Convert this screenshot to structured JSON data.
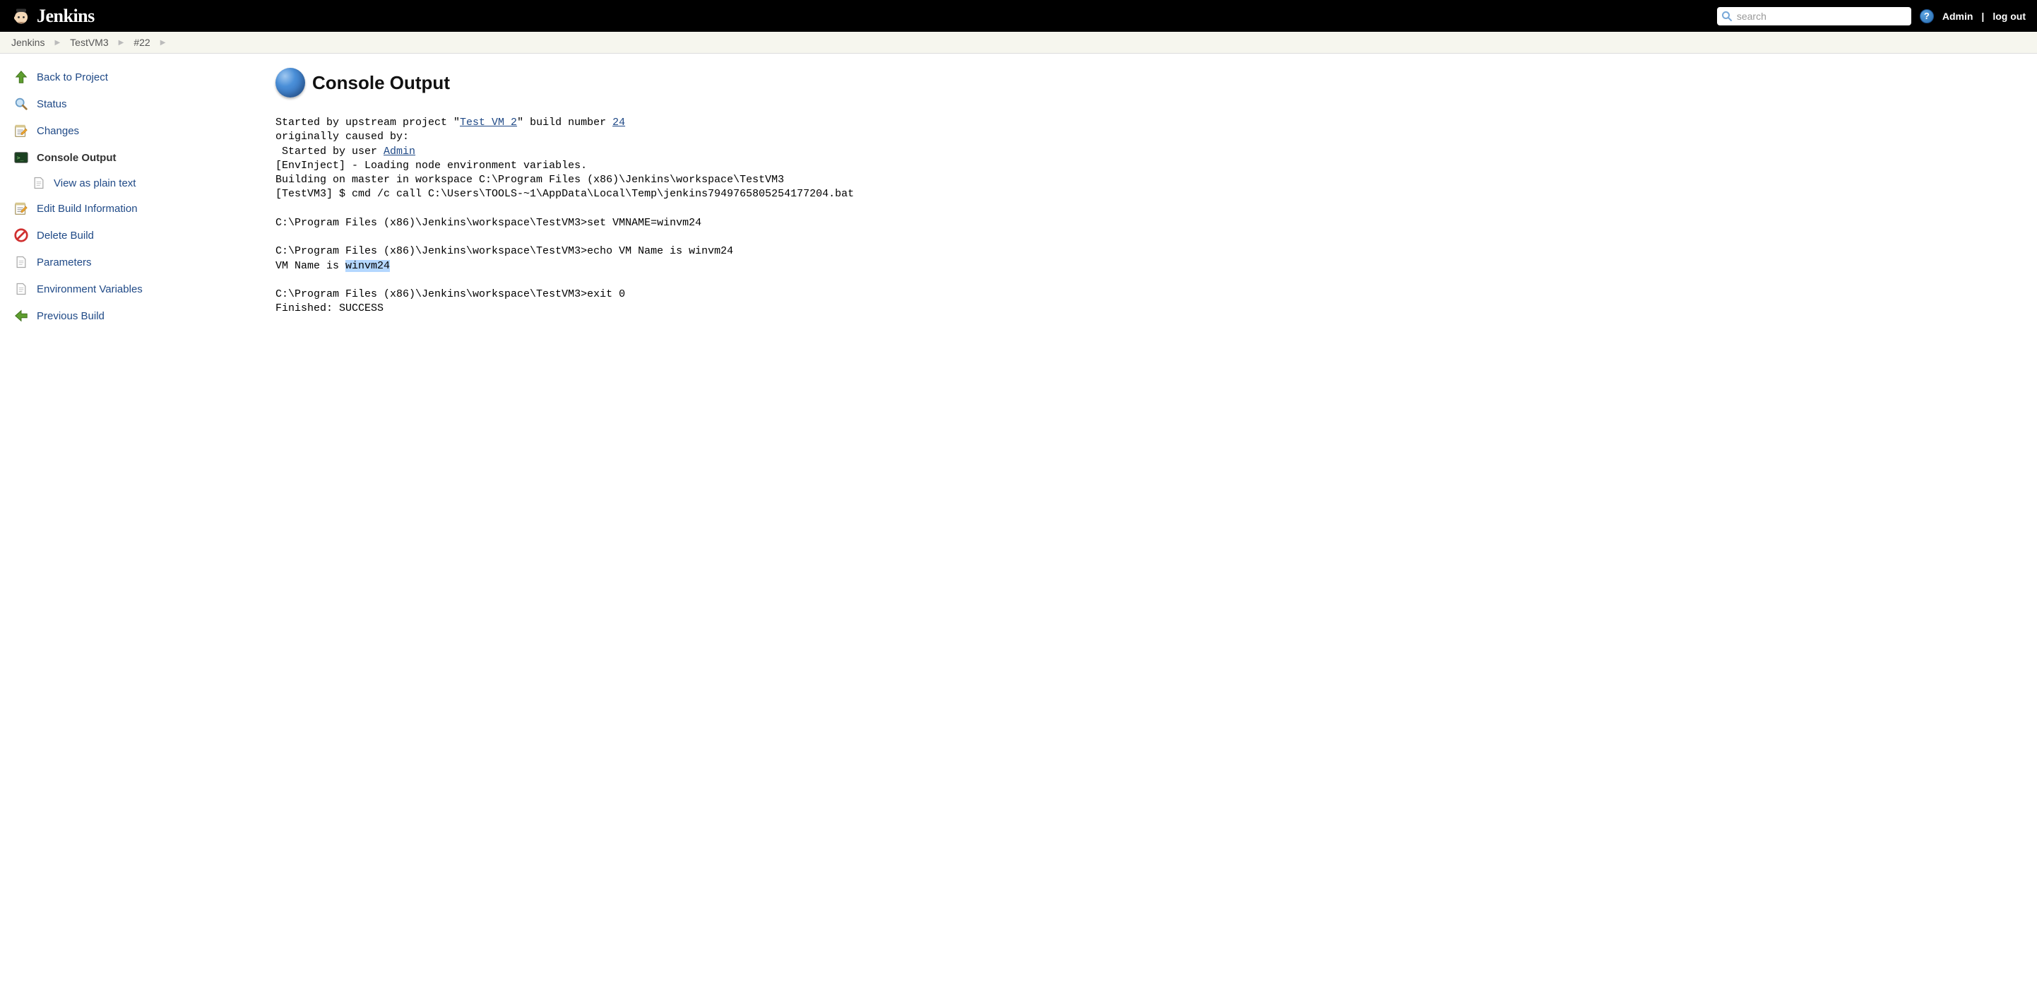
{
  "header": {
    "title": "Jenkins",
    "search_placeholder": "search",
    "user_label": "Admin",
    "logout_label": "log out"
  },
  "breadcrumbs": [
    {
      "label": "Jenkins"
    },
    {
      "label": "TestVM3"
    },
    {
      "label": "#22"
    }
  ],
  "sidebar": {
    "items": [
      {
        "id": "back",
        "label": "Back to Project",
        "icon": "up-arrow-icon"
      },
      {
        "id": "status",
        "label": "Status",
        "icon": "magnifier-icon"
      },
      {
        "id": "changes",
        "label": "Changes",
        "icon": "notepad-pencil-icon"
      },
      {
        "id": "console",
        "label": "Console Output",
        "icon": "terminal-icon",
        "active": true,
        "sub": [
          {
            "id": "plain",
            "label": "View as plain text",
            "icon": "document-icon"
          }
        ]
      },
      {
        "id": "edit",
        "label": "Edit Build Information",
        "icon": "notepad-pencil-icon"
      },
      {
        "id": "delete",
        "label": "Delete Build",
        "icon": "no-entry-icon"
      },
      {
        "id": "params",
        "label": "Parameters",
        "icon": "document-icon"
      },
      {
        "id": "env",
        "label": "Environment Variables",
        "icon": "document-icon"
      },
      {
        "id": "prev",
        "label": "Previous Build",
        "icon": "left-arrow-icon"
      }
    ]
  },
  "main": {
    "title": "Console Output",
    "log": {
      "line1_a": "Started by upstream project \"",
      "line1_link": "Test VM 2",
      "line1_b": "\" build number ",
      "line1_build_link": "24",
      "line2": "originally caused by:",
      "line3_a": " Started by user ",
      "line3_link": "Admin",
      "line4": "[EnvInject] - Loading node environment variables.",
      "line5": "Building on master in workspace C:\\Program Files (x86)\\Jenkins\\workspace\\TestVM3",
      "line6": "[TestVM3] $ cmd /c call C:\\Users\\TOOLS-~1\\AppData\\Local\\Temp\\jenkins7949765805254177204.bat",
      "line7": "",
      "line8": "C:\\Program Files (x86)\\Jenkins\\workspace\\TestVM3>set VMNAME=winvm24",
      "line9": "",
      "line10": "C:\\Program Files (x86)\\Jenkins\\workspace\\TestVM3>echo VM Name is winvm24",
      "line11_a": "VM Name is ",
      "line11_hl": "winvm24",
      "line12": "",
      "line13": "C:\\Program Files (x86)\\Jenkins\\workspace\\TestVM3>exit 0",
      "line14": "Finished: SUCCESS"
    }
  }
}
